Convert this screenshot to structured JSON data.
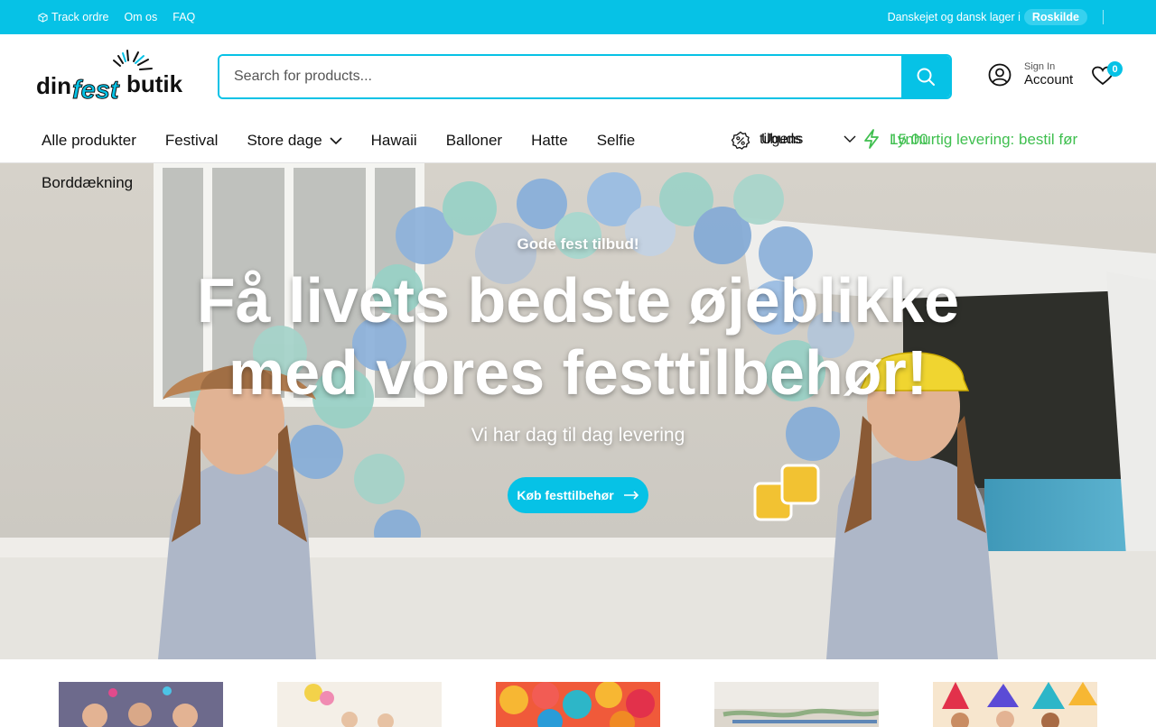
{
  "topbar": {
    "links": [
      "Track ordre",
      "Om os",
      "FAQ"
    ],
    "info_text": "Danskejet og dansk lager i",
    "location": "Roskilde"
  },
  "header": {
    "logo_text": "dinfestbutik",
    "search_placeholder": "Search for products...",
    "account_small": "Sign In",
    "account_big": "Account",
    "wishlist_count": "0"
  },
  "nav": {
    "items": [
      "Alle produkter",
      "Festival",
      "Store dage",
      "Hawaii",
      "Balloner",
      "Hatte",
      "Selfie"
    ],
    "second_row_item": "Borddækning",
    "offers_label": "tilbuds",
    "offers_overlap": "Ugens",
    "promo_overlap": "Lynhurtig levering: bestil før kl",
    "promo_time": "15.00"
  },
  "hero": {
    "eyebrow": "Gode fest tilbud!",
    "headline": "Få livets bedste øjeblikke med vores festtilbehør!",
    "subline": "Vi har dag til dag levering",
    "cta_label": "Køb festtilbehør"
  },
  "colors": {
    "brand": "#06c2e6",
    "promo_green": "#3fbf4f"
  }
}
